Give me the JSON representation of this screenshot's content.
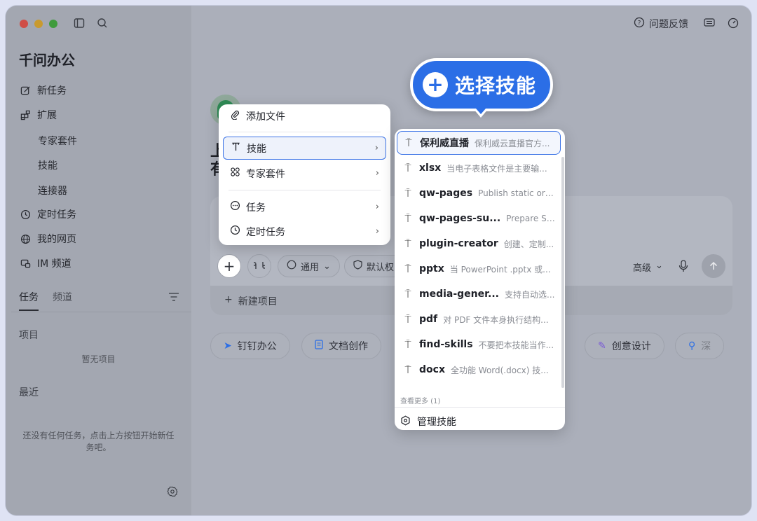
{
  "app": {
    "title": "千问办公"
  },
  "sidebar": {
    "nav": [
      {
        "label": "新任务",
        "icon": "edit-icon"
      },
      {
        "label": "扩展",
        "icon": "extensions-icon"
      }
    ],
    "sub": [
      "专家套件",
      "技能",
      "连接器"
    ],
    "nav2": [
      {
        "label": "定时任务",
        "icon": "clock-icon"
      },
      {
        "label": "我的网页",
        "icon": "globe-icon"
      },
      {
        "label": "IM 频道",
        "icon": "chat-icon"
      }
    ],
    "tabs": {
      "tasks": "任务",
      "channels": "频道"
    },
    "projects_label": "项目",
    "projects_empty": "暂无项目",
    "recent_label": "最近",
    "recent_empty_1": "还没有任何任务，点击上方按钮开始新任",
    "recent_empty_2": "务吧。"
  },
  "header": {
    "feedback": "问题反馈"
  },
  "main": {
    "heading_1": "上",
    "heading_2": "有",
    "new_project": "新建项目",
    "mode_label": "通用",
    "permission_label": "默认权",
    "advanced_label": "高级",
    "chips": [
      "钉钉办公",
      "文档创作",
      "创意设计",
      "深"
    ]
  },
  "menu": {
    "items": [
      {
        "label": "添加文件",
        "icon": "paperclip-icon"
      },
      {
        "label": "技能",
        "icon": "skill-icon"
      },
      {
        "label": "专家套件",
        "icon": "grid-icon"
      },
      {
        "label": "任务",
        "icon": "message-icon"
      },
      {
        "label": "定时任务",
        "icon": "clock-icon"
      }
    ]
  },
  "skills": {
    "items": [
      {
        "name": "保利威直播",
        "desc": "保利威云直播官方..."
      },
      {
        "name": "xlsx",
        "desc": "当电子表格文件是主要输..."
      },
      {
        "name": "qw-pages",
        "desc": "Publish static or ..."
      },
      {
        "name": "qw-pages-su...",
        "desc": "Prepare Su..."
      },
      {
        "name": "plugin-creator",
        "desc": "创建、定制..."
      },
      {
        "name": "pptx",
        "desc": "当 PowerPoint .pptx 或..."
      },
      {
        "name": "media-gener...",
        "desc": "支持自动选..."
      },
      {
        "name": "pdf",
        "desc": "对 PDF 文件本身执行结构..."
      },
      {
        "name": "find-skills",
        "desc": "不要把本技能当作..."
      },
      {
        "name": "docx",
        "desc": "全功能 Word(.docx) 技..."
      }
    ],
    "more": "查看更多 (1)",
    "manage": "管理技能"
  },
  "callout": {
    "text": "选择技能"
  },
  "colors": {
    "accent": "#2b6ee6",
    "sidebar_bg": "#a3a7b1",
    "overlay_bg": "#abafba"
  }
}
